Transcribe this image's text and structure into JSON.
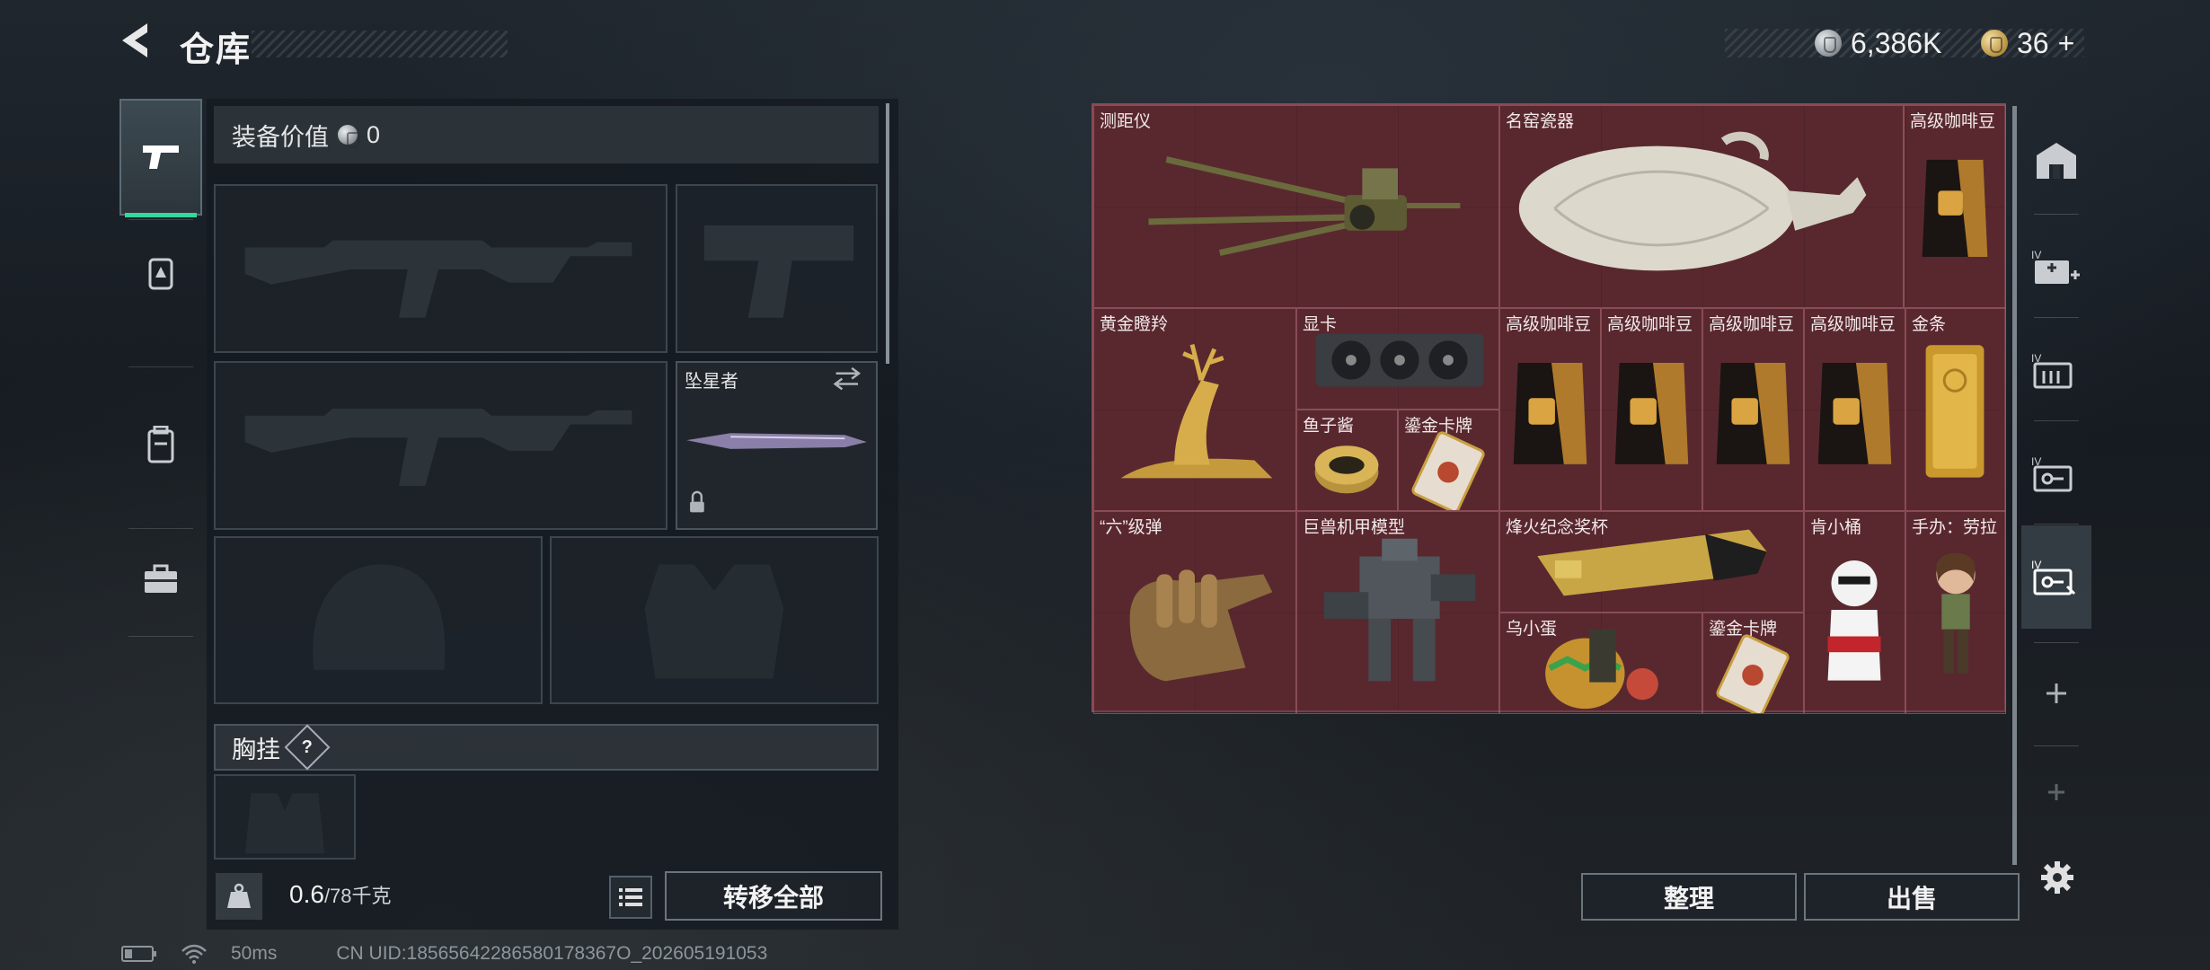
{
  "header": {
    "title": "仓库"
  },
  "currency": {
    "silver": "6,386K",
    "gold": "36",
    "gold_add": "+"
  },
  "equipment": {
    "value_label": "装备价值",
    "value": "0",
    "melee_name": "坠星者",
    "chest_label": "胸挂",
    "chest_help": "?"
  },
  "bottom": {
    "weight_current": "0.6",
    "weight_max": "/78千克",
    "transfer_all": "转移全部",
    "sort": "整理",
    "sell": "出售"
  },
  "storage": {
    "items": [
      {
        "name": "测距仪"
      },
      {
        "name": "名窑瓷器"
      },
      {
        "name": "高级咖啡豆"
      },
      {
        "name": "黄金瞪羚"
      },
      {
        "name": "显卡"
      },
      {
        "name": "高级咖啡豆"
      },
      {
        "name": "高级咖啡豆"
      },
      {
        "name": "高级咖啡豆"
      },
      {
        "name": "高级咖啡豆"
      },
      {
        "name": "金条"
      },
      {
        "name": "鱼子酱"
      },
      {
        "name": "鎏金卡牌"
      },
      {
        "name": "“六”级弹"
      },
      {
        "name": "巨兽机甲模型"
      },
      {
        "name": "烽火纪念奖杯"
      },
      {
        "name": "肯小桶"
      },
      {
        "name": "手办：劳拉"
      },
      {
        "name": "乌小蛋"
      },
      {
        "name": "鎏金卡牌"
      }
    ]
  },
  "status": {
    "ping": "50ms",
    "uid": "CN UID:18565642286580178367O_202605191053"
  },
  "colors": {
    "accent_green": "#35d79a",
    "storage_bg": "#5a2a31"
  }
}
